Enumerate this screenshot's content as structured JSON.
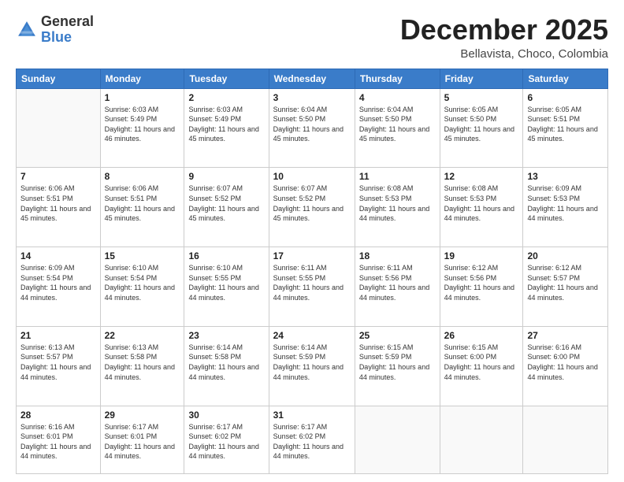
{
  "header": {
    "logo_general": "General",
    "logo_blue": "Blue",
    "month_title": "December 2025",
    "subtitle": "Bellavista, Choco, Colombia"
  },
  "days_of_week": [
    "Sunday",
    "Monday",
    "Tuesday",
    "Wednesday",
    "Thursday",
    "Friday",
    "Saturday"
  ],
  "weeks": [
    [
      {
        "day": "",
        "empty": true
      },
      {
        "day": "1",
        "sunrise": "Sunrise: 6:03 AM",
        "sunset": "Sunset: 5:49 PM",
        "daylight": "Daylight: 11 hours and 46 minutes."
      },
      {
        "day": "2",
        "sunrise": "Sunrise: 6:03 AM",
        "sunset": "Sunset: 5:49 PM",
        "daylight": "Daylight: 11 hours and 45 minutes."
      },
      {
        "day": "3",
        "sunrise": "Sunrise: 6:04 AM",
        "sunset": "Sunset: 5:50 PM",
        "daylight": "Daylight: 11 hours and 45 minutes."
      },
      {
        "day": "4",
        "sunrise": "Sunrise: 6:04 AM",
        "sunset": "Sunset: 5:50 PM",
        "daylight": "Daylight: 11 hours and 45 minutes."
      },
      {
        "day": "5",
        "sunrise": "Sunrise: 6:05 AM",
        "sunset": "Sunset: 5:50 PM",
        "daylight": "Daylight: 11 hours and 45 minutes."
      },
      {
        "day": "6",
        "sunrise": "Sunrise: 6:05 AM",
        "sunset": "Sunset: 5:51 PM",
        "daylight": "Daylight: 11 hours and 45 minutes."
      }
    ],
    [
      {
        "day": "7",
        "sunrise": "Sunrise: 6:06 AM",
        "sunset": "Sunset: 5:51 PM",
        "daylight": "Daylight: 11 hours and 45 minutes."
      },
      {
        "day": "8",
        "sunrise": "Sunrise: 6:06 AM",
        "sunset": "Sunset: 5:51 PM",
        "daylight": "Daylight: 11 hours and 45 minutes."
      },
      {
        "day": "9",
        "sunrise": "Sunrise: 6:07 AM",
        "sunset": "Sunset: 5:52 PM",
        "daylight": "Daylight: 11 hours and 45 minutes."
      },
      {
        "day": "10",
        "sunrise": "Sunrise: 6:07 AM",
        "sunset": "Sunset: 5:52 PM",
        "daylight": "Daylight: 11 hours and 45 minutes."
      },
      {
        "day": "11",
        "sunrise": "Sunrise: 6:08 AM",
        "sunset": "Sunset: 5:53 PM",
        "daylight": "Daylight: 11 hours and 44 minutes."
      },
      {
        "day": "12",
        "sunrise": "Sunrise: 6:08 AM",
        "sunset": "Sunset: 5:53 PM",
        "daylight": "Daylight: 11 hours and 44 minutes."
      },
      {
        "day": "13",
        "sunrise": "Sunrise: 6:09 AM",
        "sunset": "Sunset: 5:53 PM",
        "daylight": "Daylight: 11 hours and 44 minutes."
      }
    ],
    [
      {
        "day": "14",
        "sunrise": "Sunrise: 6:09 AM",
        "sunset": "Sunset: 5:54 PM",
        "daylight": "Daylight: 11 hours and 44 minutes."
      },
      {
        "day": "15",
        "sunrise": "Sunrise: 6:10 AM",
        "sunset": "Sunset: 5:54 PM",
        "daylight": "Daylight: 11 hours and 44 minutes."
      },
      {
        "day": "16",
        "sunrise": "Sunrise: 6:10 AM",
        "sunset": "Sunset: 5:55 PM",
        "daylight": "Daylight: 11 hours and 44 minutes."
      },
      {
        "day": "17",
        "sunrise": "Sunrise: 6:11 AM",
        "sunset": "Sunset: 5:55 PM",
        "daylight": "Daylight: 11 hours and 44 minutes."
      },
      {
        "day": "18",
        "sunrise": "Sunrise: 6:11 AM",
        "sunset": "Sunset: 5:56 PM",
        "daylight": "Daylight: 11 hours and 44 minutes."
      },
      {
        "day": "19",
        "sunrise": "Sunrise: 6:12 AM",
        "sunset": "Sunset: 5:56 PM",
        "daylight": "Daylight: 11 hours and 44 minutes."
      },
      {
        "day": "20",
        "sunrise": "Sunrise: 6:12 AM",
        "sunset": "Sunset: 5:57 PM",
        "daylight": "Daylight: 11 hours and 44 minutes."
      }
    ],
    [
      {
        "day": "21",
        "sunrise": "Sunrise: 6:13 AM",
        "sunset": "Sunset: 5:57 PM",
        "daylight": "Daylight: 11 hours and 44 minutes."
      },
      {
        "day": "22",
        "sunrise": "Sunrise: 6:13 AM",
        "sunset": "Sunset: 5:58 PM",
        "daylight": "Daylight: 11 hours and 44 minutes."
      },
      {
        "day": "23",
        "sunrise": "Sunrise: 6:14 AM",
        "sunset": "Sunset: 5:58 PM",
        "daylight": "Daylight: 11 hours and 44 minutes."
      },
      {
        "day": "24",
        "sunrise": "Sunrise: 6:14 AM",
        "sunset": "Sunset: 5:59 PM",
        "daylight": "Daylight: 11 hours and 44 minutes."
      },
      {
        "day": "25",
        "sunrise": "Sunrise: 6:15 AM",
        "sunset": "Sunset: 5:59 PM",
        "daylight": "Daylight: 11 hours and 44 minutes."
      },
      {
        "day": "26",
        "sunrise": "Sunrise: 6:15 AM",
        "sunset": "Sunset: 6:00 PM",
        "daylight": "Daylight: 11 hours and 44 minutes."
      },
      {
        "day": "27",
        "sunrise": "Sunrise: 6:16 AM",
        "sunset": "Sunset: 6:00 PM",
        "daylight": "Daylight: 11 hours and 44 minutes."
      }
    ],
    [
      {
        "day": "28",
        "sunrise": "Sunrise: 6:16 AM",
        "sunset": "Sunset: 6:01 PM",
        "daylight": "Daylight: 11 hours and 44 minutes."
      },
      {
        "day": "29",
        "sunrise": "Sunrise: 6:17 AM",
        "sunset": "Sunset: 6:01 PM",
        "daylight": "Daylight: 11 hours and 44 minutes."
      },
      {
        "day": "30",
        "sunrise": "Sunrise: 6:17 AM",
        "sunset": "Sunset: 6:02 PM",
        "daylight": "Daylight: 11 hours and 44 minutes."
      },
      {
        "day": "31",
        "sunrise": "Sunrise: 6:17 AM",
        "sunset": "Sunset: 6:02 PM",
        "daylight": "Daylight: 11 hours and 44 minutes."
      },
      {
        "day": "",
        "empty": true
      },
      {
        "day": "",
        "empty": true
      },
      {
        "day": "",
        "empty": true
      }
    ]
  ]
}
